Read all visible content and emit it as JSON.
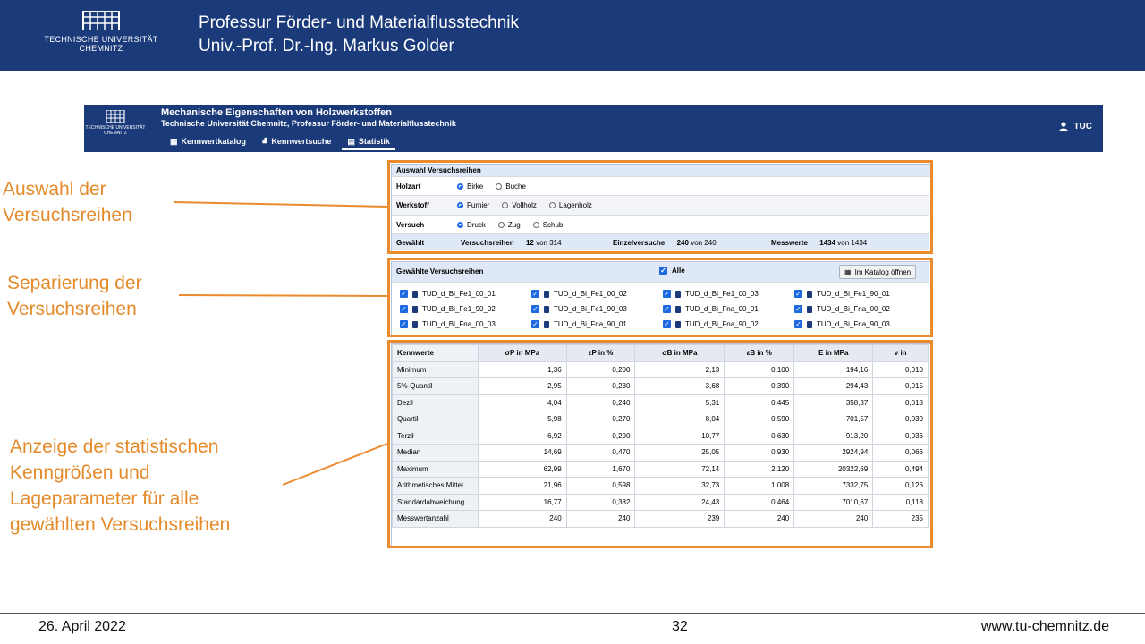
{
  "slide": {
    "university": "TECHNISCHE UNIVERSITÄT CHEMNITZ",
    "header_line1": "Professur Förder- und Materialflusstechnik",
    "header_line2": "Univ.-Prof. Dr.-Ing. Markus Golder",
    "footer_date": "26. April 2022",
    "page_number": "32",
    "footer_url": "www.tu-chemnitz.de"
  },
  "annotations": {
    "auswahl": "Auswahl der Versuchsreihen",
    "separierung": "Separierung der Versuchsreihen",
    "anzeige": "Anzeige der statistischen Kenngrößen und Lageparameter für alle gewählten Versuchsreihen"
  },
  "app": {
    "logo_text": "TECHNISCHE UNIVERSITÄT CHEMNITZ",
    "title": "Mechanische Eigenschaften von Holzwerkstoffen",
    "subtitle": "Technische Universität Chemnitz, Professur Förder- und Materialflusstechnik",
    "nav": [
      "Kennwertkatalog",
      "Kennwertsuche",
      "Statistik"
    ],
    "user": "TUC"
  },
  "auswahl": {
    "title": "Auswahl Versuchsreihen",
    "rows": [
      {
        "label": "Holzart",
        "options": [
          "Birke",
          "Buche"
        ],
        "selected": 0
      },
      {
        "label": "Werkstoff",
        "options": [
          "Furnier",
          "Vollholz",
          "Lagenholz"
        ],
        "selected": 0
      },
      {
        "label": "Versuch",
        "options": [
          "Druck",
          "Zug",
          "Schub"
        ],
        "selected": 0
      }
    ],
    "gewaehlt_label": "Gewählt",
    "summary": [
      {
        "label": "Versuchsreihen",
        "value": "12",
        "total": "von 314"
      },
      {
        "label": "Einzelversuche",
        "value": "240",
        "total": "von 240"
      },
      {
        "label": "Messwerte",
        "value": "1434",
        "total": "von 1434"
      }
    ]
  },
  "gewaehlte": {
    "title": "Gewählte Versuchsreihen",
    "alle": "Alle",
    "katalog_button": "Im Katalog öffnen",
    "series": [
      "TUD_d_Bi_Fe1_00_01",
      "TUD_d_Bi_Fe1_00_02",
      "TUD_d_Bi_Fe1_00_03",
      "TUD_d_Bi_Fe1_90_01",
      "TUD_d_Bi_Fe1_90_02",
      "TUD_d_Bi_Fe1_90_03",
      "TUD_d_Bi_Fna_00_01",
      "TUD_d_Bi_Fna_00_02",
      "TUD_d_Bi_Fna_00_03",
      "TUD_d_Bi_Fna_90_01",
      "TUD_d_Bi_Fna_90_02",
      "TUD_d_Bi_Fna_90_03"
    ]
  },
  "stats": {
    "headers": [
      "Kennwerte",
      "σP in MPa",
      "εP in %",
      "σB in MPa",
      "εB in %",
      "E in MPa",
      "ν in"
    ],
    "rows": [
      [
        "Minimum",
        "1,36",
        "0,200",
        "2,13",
        "0,100",
        "194,16",
        "0,010"
      ],
      [
        "5%-Quantil",
        "2,95",
        "0,230",
        "3,68",
        "0,390",
        "294,43",
        "0,015"
      ],
      [
        "Dezil",
        "4,04",
        "0,240",
        "5,31",
        "0,445",
        "358,37",
        "0,018"
      ],
      [
        "Quartil",
        "5,98",
        "0,270",
        "8,04",
        "0,590",
        "701,57",
        "0,030"
      ],
      [
        "Terzil",
        "6,92",
        "0,290",
        "10,77",
        "0,630",
        "913,20",
        "0,036"
      ],
      [
        "Median",
        "14,69",
        "0,470",
        "25,05",
        "0,930",
        "2924,94",
        "0,066"
      ],
      [
        "Maximum",
        "62,99",
        "1,670",
        "72,14",
        "2,120",
        "20322,69",
        "0,494"
      ],
      [
        "Arithmetisches Mittel",
        "21,96",
        "0,598",
        "32,73",
        "1,008",
        "7332,75",
        "0,126"
      ],
      [
        "Standardabweichung",
        "16,77",
        "0,382",
        "24,43",
        "0,464",
        "7010,67",
        "0,118"
      ],
      [
        "Messwertanzahl",
        "240",
        "240",
        "239",
        "240",
        "240",
        "235"
      ]
    ]
  },
  "colors": {
    "brand": "#1b3a7a",
    "accent": "#ec8a2e",
    "checkbox": "#1d6ae0"
  }
}
